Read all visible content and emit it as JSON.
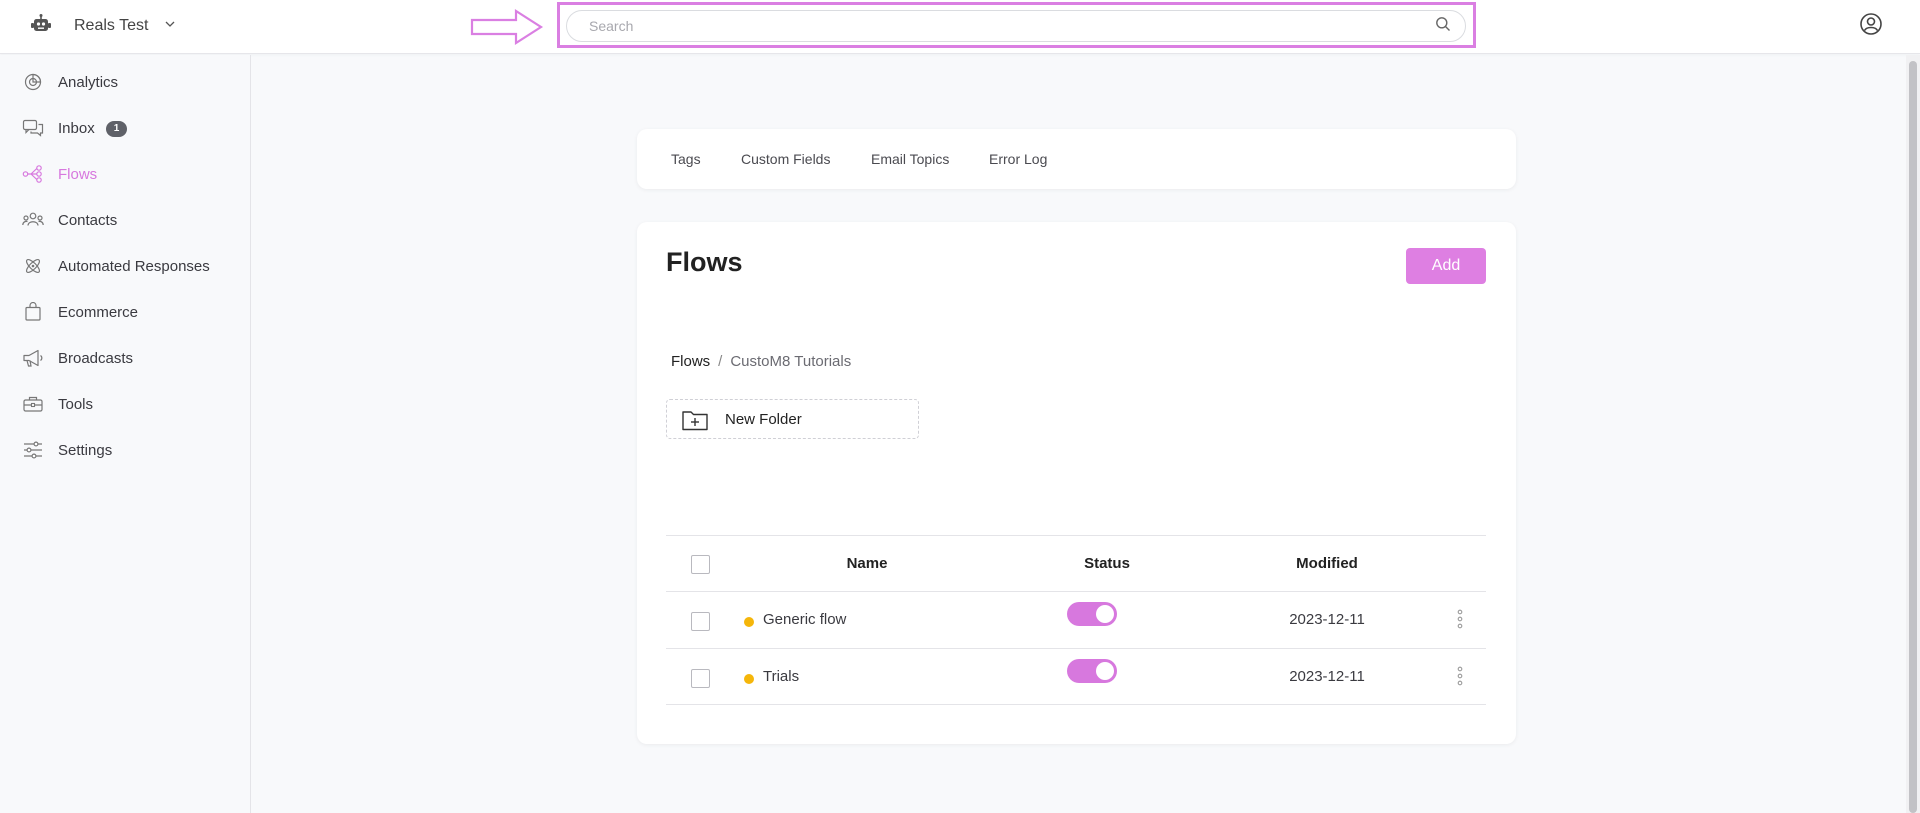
{
  "header": {
    "workspace_name": "Reals Test",
    "search_placeholder": "Search"
  },
  "sidebar": {
    "items": [
      {
        "label": "Analytics",
        "icon": "analytics-icon"
      },
      {
        "label": "Inbox",
        "icon": "inbox-icon",
        "badge": "1"
      },
      {
        "label": "Flows",
        "icon": "flows-icon",
        "active": true
      },
      {
        "label": "Contacts",
        "icon": "contacts-icon"
      },
      {
        "label": "Automated Responses",
        "icon": "automated-responses-icon"
      },
      {
        "label": "Ecommerce",
        "icon": "ecommerce-icon"
      },
      {
        "label": "Broadcasts",
        "icon": "broadcasts-icon"
      },
      {
        "label": "Tools",
        "icon": "tools-icon"
      },
      {
        "label": "Settings",
        "icon": "settings-icon"
      }
    ]
  },
  "tabs": [
    "Tags",
    "Custom Fields",
    "Email Topics",
    "Error Log"
  ],
  "main": {
    "title": "Flows",
    "add_label": "Add",
    "breadcrumb": {
      "root": "Flows",
      "separator": "/",
      "current": "CustoM8 Tutorials"
    },
    "new_folder_label": "New Folder",
    "table": {
      "columns": [
        "Name",
        "Status",
        "Modified"
      ],
      "rows": [
        {
          "name": "Generic flow",
          "status_on": true,
          "modified": "2023-12-11"
        },
        {
          "name": "Trials",
          "status_on": true,
          "modified": "2023-12-11"
        }
      ]
    }
  },
  "colors": {
    "accent": "#de7fe2",
    "active_nav": "#d778de",
    "status_dot": "#f5b60a",
    "annotation": "#da7fe2"
  }
}
